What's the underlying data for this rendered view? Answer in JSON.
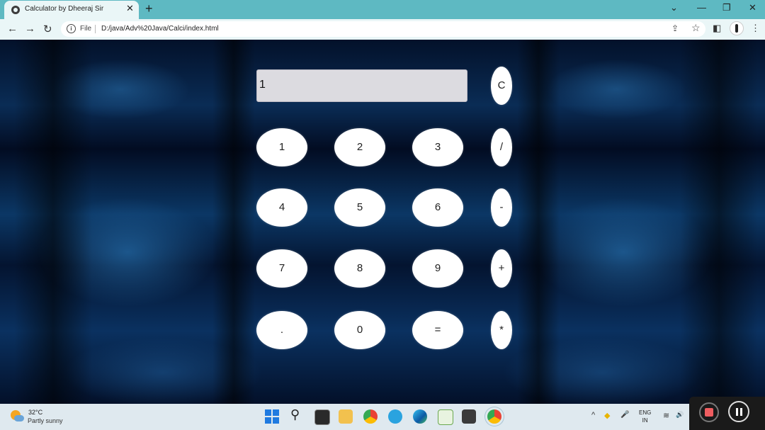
{
  "browser": {
    "tab_title": "Calculator by Dheeraj Sir",
    "tab_close": "✕",
    "new_tab": "+",
    "minimize": "⌄",
    "min": "—",
    "restore": "❐",
    "close": "✕",
    "back": "←",
    "forward": "→",
    "reload": "↻",
    "file_label": "File",
    "url": "D:/java/Adv%20Java/Calci/index.html",
    "info": "i",
    "share": "⇪",
    "star": "☆",
    "sidepanel": "◧",
    "menu": "⋮"
  },
  "calculator": {
    "display_value": "1",
    "keys": {
      "clear": "C",
      "divide": "/",
      "minus": "-",
      "plus": "+",
      "multiply": "*",
      "k1": "1",
      "k2": "2",
      "k3": "3",
      "k4": "4",
      "k5": "5",
      "k6": "6",
      "k7": "7",
      "k8": "8",
      "k9": "9",
      "dot": ".",
      "k0": "0",
      "equals": "="
    }
  },
  "taskbar": {
    "temperature": "32°C",
    "condition": "Partly sunny",
    "search_glyph": "⚲",
    "lang_top": "ENG",
    "lang_bottom": "IN",
    "tray_up": "^",
    "wifi": "≋",
    "volume": "🔊",
    "mic": "🎤"
  },
  "colors": {
    "tab_strip": "#5eb9c2",
    "toolbar": "#eaf6f7",
    "page_bg": "#0a2c55",
    "display_bg": "#dcdbe0",
    "key_bg": "#ffffff",
    "record_red": "#ef5d60"
  }
}
